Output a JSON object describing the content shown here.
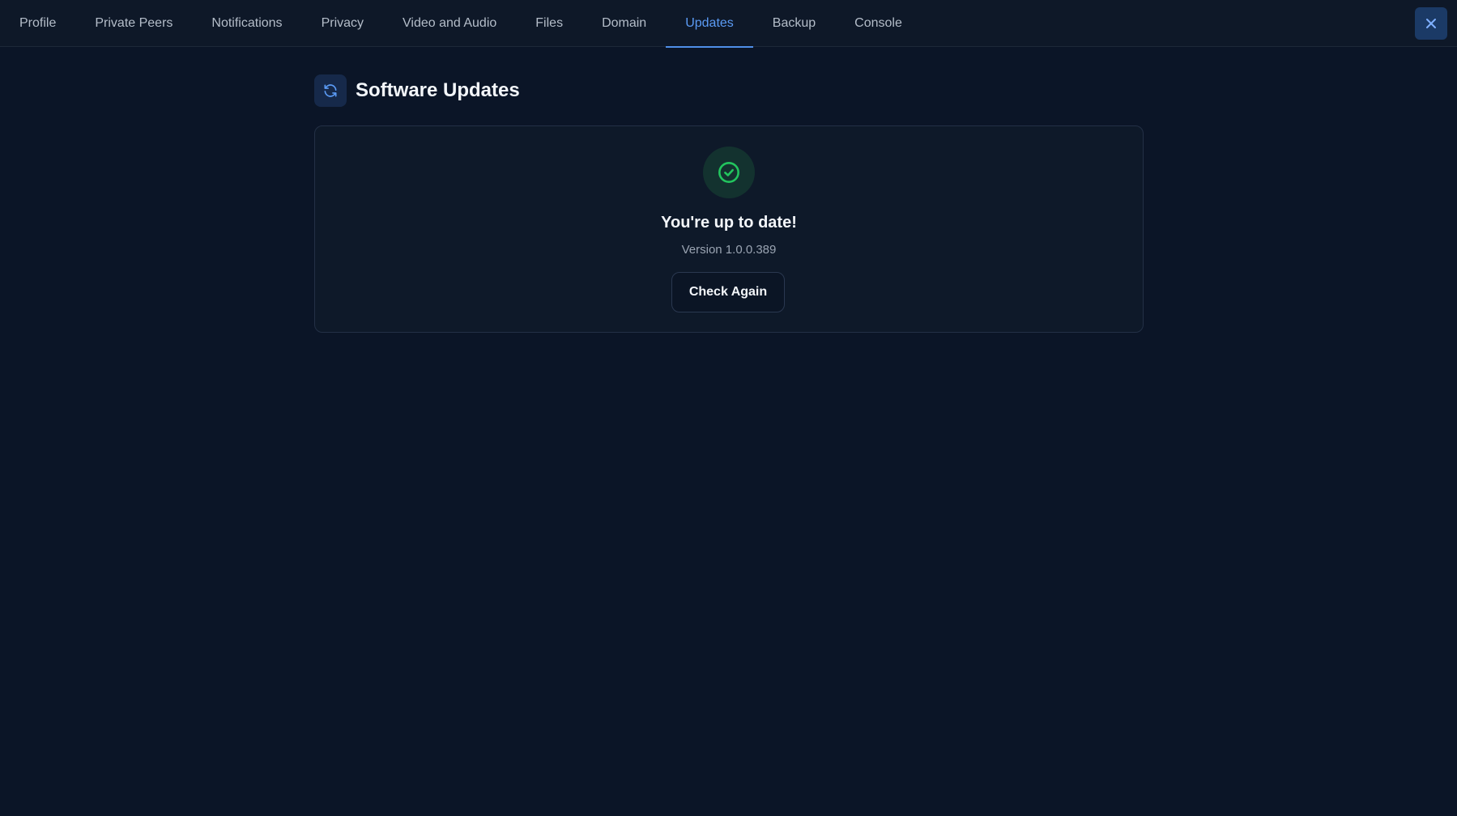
{
  "tabs": [
    {
      "label": "Profile",
      "active": false
    },
    {
      "label": "Private Peers",
      "active": false
    },
    {
      "label": "Notifications",
      "active": false
    },
    {
      "label": "Privacy",
      "active": false
    },
    {
      "label": "Video and Audio",
      "active": false
    },
    {
      "label": "Files",
      "active": false
    },
    {
      "label": "Domain",
      "active": false
    },
    {
      "label": "Updates",
      "active": true
    },
    {
      "label": "Backup",
      "active": false
    },
    {
      "label": "Console",
      "active": false
    }
  ],
  "close_icon": "close-icon",
  "header": {
    "icon": "refresh-icon",
    "title": "Software Updates"
  },
  "status": {
    "icon": "check-circle-icon",
    "title": "You're up to date!",
    "version": "Version 1.0.0.389",
    "button_label": "Check Again"
  },
  "colors": {
    "background": "#0b1527",
    "accent": "#5b9bf5",
    "success": "#22c55e",
    "card_border": "#233046"
  }
}
